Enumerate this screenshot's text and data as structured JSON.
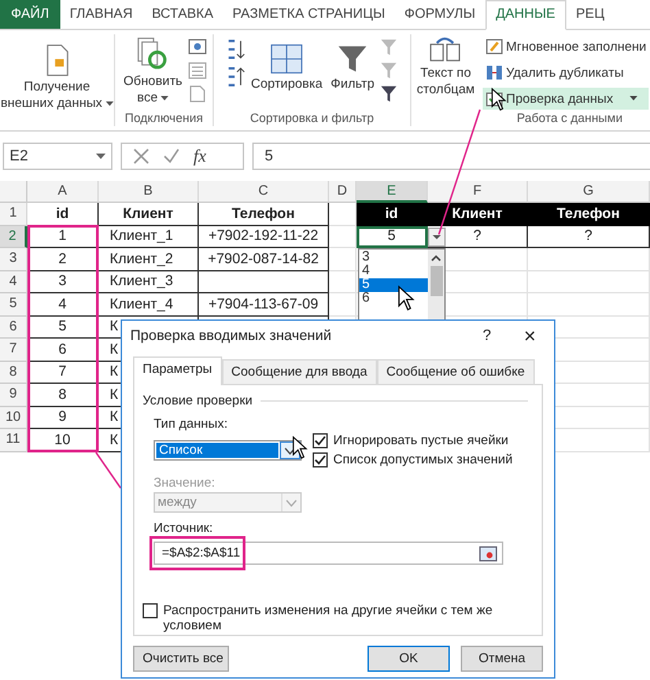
{
  "ribbon": {
    "tabs": [
      {
        "label": "ФАЙЛ",
        "kind": "file",
        "selected": false
      },
      {
        "label": "ГЛАВНАЯ",
        "kind": "tab",
        "selected": false
      },
      {
        "label": "ВСТАВКА",
        "kind": "tab",
        "selected": false
      },
      {
        "label": "РАЗМЕТКА СТРАНИЦЫ",
        "kind": "tab",
        "selected": false
      },
      {
        "label": "ФОРМУЛЫ",
        "kind": "tab",
        "selected": false
      },
      {
        "label": "ДАННЫЕ",
        "kind": "tab",
        "selected": true
      },
      {
        "label": "РЕЦ",
        "kind": "tab",
        "selected": false
      }
    ],
    "get_external": {
      "lines": [
        "Получение",
        "внешних данных"
      ]
    },
    "connections": {
      "label": "Подключения",
      "refresh": [
        "Обновить",
        "все"
      ]
    },
    "sort_filter": {
      "label": "Сортировка и фильтр",
      "sort": "Сортировка",
      "filter": "Фильтр"
    },
    "data_tools": {
      "label": "Работа с данными",
      "text_to_columns": [
        "Текст по",
        "столбцам"
      ],
      "items": [
        {
          "label": "Мгновенное заполнени",
          "kind": "flash",
          "selected": false
        },
        {
          "label": "Удалить дубликаты",
          "kind": "duplicates",
          "selected": false
        },
        {
          "label": "Проверка данных",
          "kind": "validation",
          "selected": true
        }
      ]
    }
  },
  "formula_bar": {
    "name_box": "E2",
    "function_label": "fx",
    "value": "5"
  },
  "sheet": {
    "columns": [
      {
        "label": "A",
        "selected": false
      },
      {
        "label": "B",
        "selected": false
      },
      {
        "label": "C",
        "selected": false
      },
      {
        "label": "D",
        "selected": false
      },
      {
        "label": "E",
        "selected": true
      },
      {
        "label": "F",
        "selected": false
      },
      {
        "label": "G",
        "selected": false
      }
    ],
    "rows": [
      {
        "number": "1",
        "selected": false,
        "kind": "header",
        "cells": {
          "A": {
            "text": "id"
          },
          "B": {
            "text": "Клиент"
          },
          "C": {
            "text": "Телефон"
          },
          "E": {
            "text": "id",
            "dark": true
          },
          "F": {
            "text": "Клиент",
            "dark": true
          },
          "G": {
            "text": "Телефон",
            "dark": true
          }
        }
      },
      {
        "number": "2",
        "selected": true,
        "kind": "data",
        "cells": {
          "A": {
            "text": "1"
          },
          "B": {
            "text": "Клиент_1"
          },
          "C": {
            "text": "+7902-192-11-22"
          },
          "E": {
            "text": "5",
            "selected": true,
            "dropdown": true
          },
          "F": {
            "text": "?"
          },
          "G": {
            "text": "?"
          }
        }
      },
      {
        "number": "3",
        "selected": false,
        "kind": "data",
        "cells": {
          "A": {
            "text": "2"
          },
          "B": {
            "text": "Клиент_2"
          },
          "C": {
            "text": "+7902-087-14-82"
          }
        }
      },
      {
        "number": "4",
        "selected": false,
        "kind": "data",
        "cells": {
          "A": {
            "text": "3"
          },
          "B": {
            "text": "Клиент_3"
          }
        }
      },
      {
        "number": "5",
        "selected": false,
        "kind": "data",
        "cells": {
          "A": {
            "text": "4"
          },
          "B": {
            "text": "Клиент_4"
          },
          "C": {
            "text": "+7904-113-67-09"
          }
        }
      },
      {
        "number": "6",
        "selected": false,
        "kind": "data",
        "cells": {
          "A": {
            "text": "5"
          },
          "B": {
            "text": "К"
          }
        }
      },
      {
        "number": "7",
        "selected": false,
        "kind": "data",
        "cells": {
          "A": {
            "text": "6"
          },
          "B": {
            "text": "К"
          }
        }
      },
      {
        "number": "8",
        "selected": false,
        "kind": "data",
        "cells": {
          "A": {
            "text": "7"
          },
          "B": {
            "text": "К"
          }
        }
      },
      {
        "number": "9",
        "selected": false,
        "kind": "data",
        "cells": {
          "A": {
            "text": "8"
          },
          "B": {
            "text": "К"
          }
        }
      },
      {
        "number": "10",
        "selected": false,
        "kind": "data",
        "cells": {
          "A": {
            "text": "9"
          },
          "B": {
            "text": "К"
          }
        }
      },
      {
        "number": "11",
        "selected": false,
        "kind": "data",
        "cells": {
          "A": {
            "text": "10"
          },
          "B": {
            "text": "К"
          }
        }
      }
    ]
  },
  "dropdown_list": {
    "items": [
      {
        "label": "3",
        "selected": false
      },
      {
        "label": "4",
        "selected": false
      },
      {
        "label": "5",
        "selected": true
      },
      {
        "label": "6",
        "selected": false
      }
    ]
  },
  "dialog": {
    "title": "Проверка вводимых значений",
    "help": "?",
    "close": "×",
    "tabs": [
      {
        "label": "Параметры",
        "selected": true
      },
      {
        "label": "Сообщение для ввода",
        "selected": false
      },
      {
        "label": "Сообщение об ошибке",
        "selected": false
      }
    ],
    "section": "Условие проверки",
    "data_type": {
      "label": "Тип данных:",
      "value": "Список",
      "disabled": false
    },
    "options": [
      {
        "label": "Игнорировать пустые ячейки",
        "checked": true
      },
      {
        "label": "Список допустимых значений",
        "checked": true
      }
    ],
    "condition": {
      "label": "Значение:",
      "value": "между",
      "disabled": true
    },
    "source": {
      "label": "Источник:",
      "value": "=$A$2:$A$11"
    },
    "apply_all": {
      "label": "Распространить изменения на другие ячейки с тем же условием",
      "checked": false
    },
    "buttons": [
      {
        "label": "Очистить все",
        "kind": "clear",
        "default": false
      },
      {
        "label": "OK",
        "kind": "ok",
        "default": true
      },
      {
        "label": "Отмена",
        "kind": "cancel",
        "default": false
      }
    ]
  }
}
